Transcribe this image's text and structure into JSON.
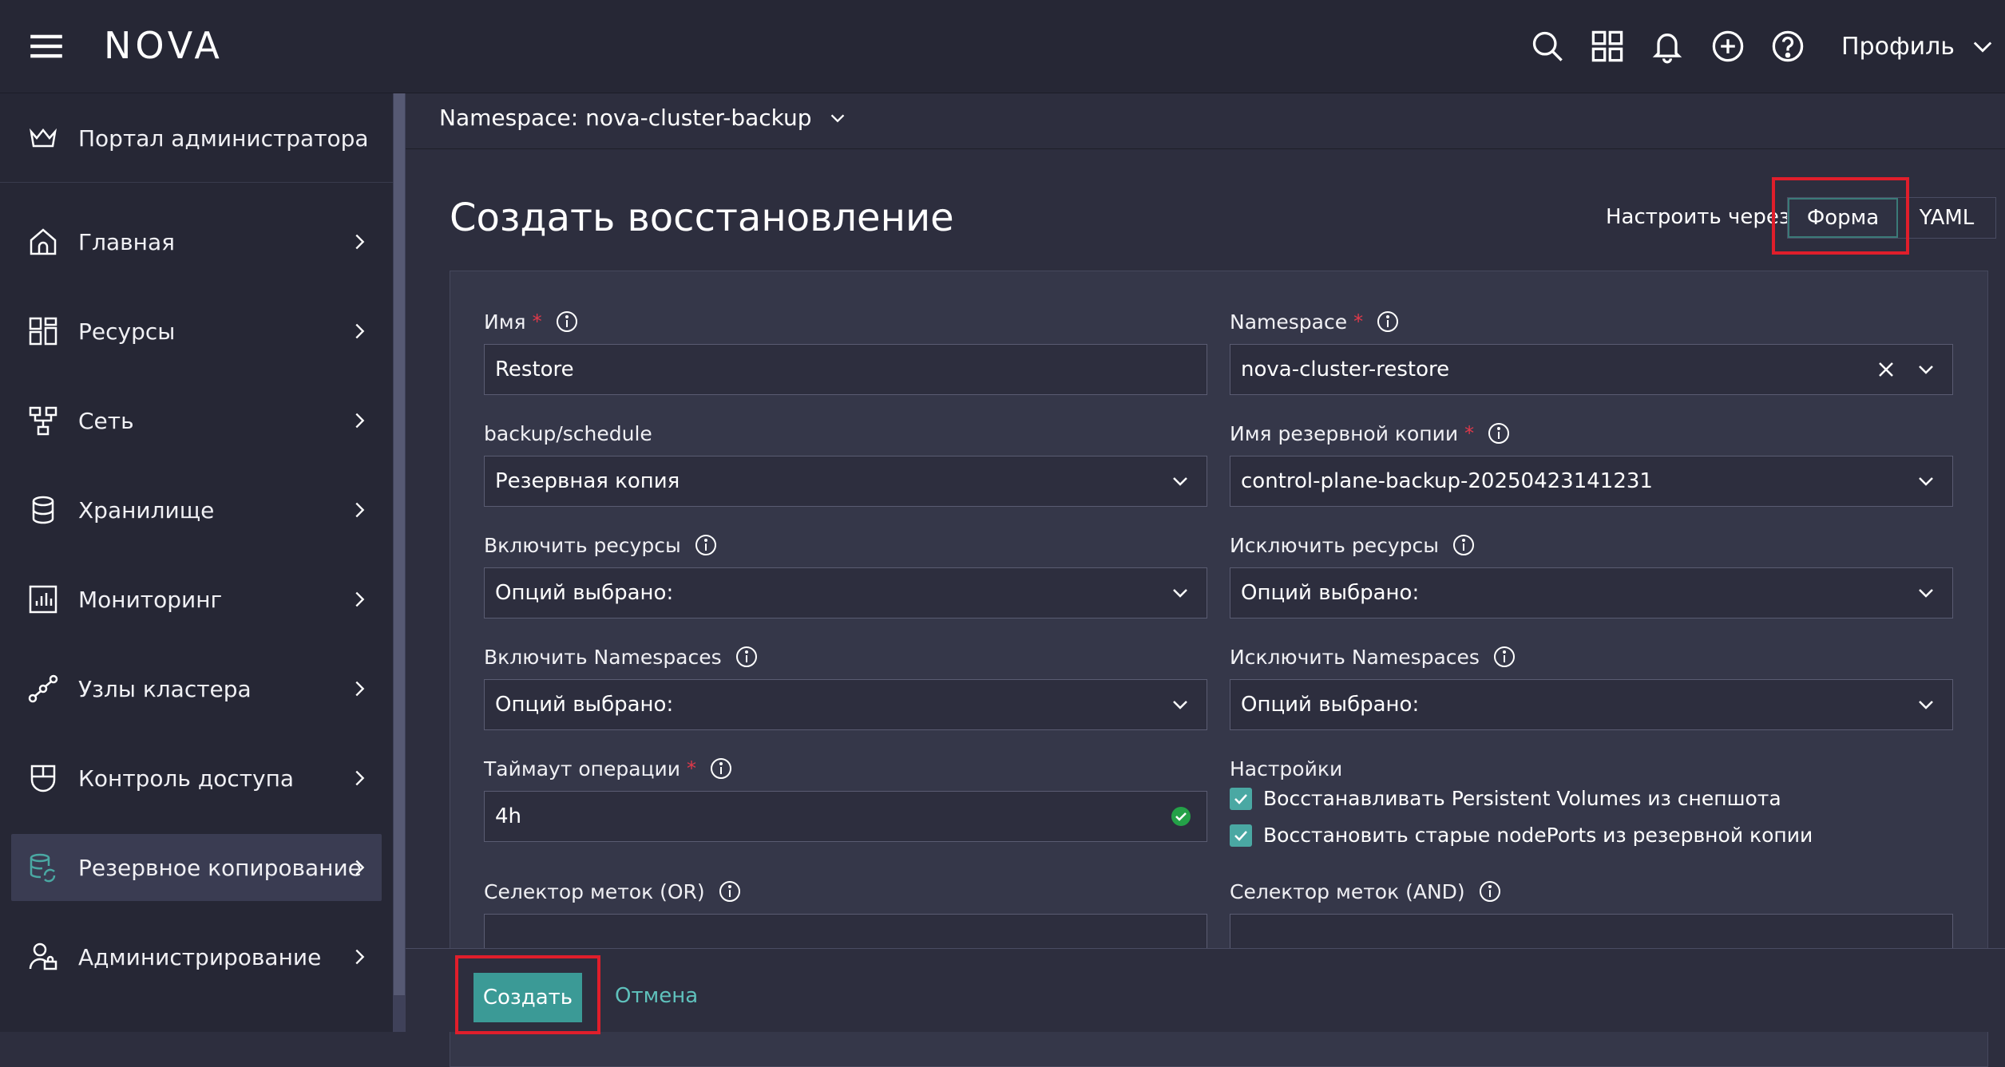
{
  "app": {
    "logo": "NOVA"
  },
  "topbar": {
    "profile_label": "Профиль"
  },
  "sidebar": {
    "admin_portal": "Портал администратора",
    "items": [
      {
        "label": "Главная"
      },
      {
        "label": "Ресурсы"
      },
      {
        "label": "Сеть"
      },
      {
        "label": "Хранилище"
      },
      {
        "label": "Мониторинг"
      },
      {
        "label": "Узлы кластера"
      },
      {
        "label": "Контроль доступа"
      },
      {
        "label": "Резервное копирование",
        "active": true
      },
      {
        "label": "Администрирование"
      }
    ]
  },
  "namespace_bar": {
    "label": "Namespace: nova-cluster-backup"
  },
  "page": {
    "title": "Создать восстановление",
    "configure_via": "Настроить через:",
    "mode_form": "Форма",
    "mode_yaml": "YAML"
  },
  "form": {
    "name": {
      "label": "Имя",
      "required": "*",
      "value": "Restore"
    },
    "namespace": {
      "label": "Namespace",
      "required": "*",
      "value": "nova-cluster-restore"
    },
    "backup_schedule": {
      "label": "backup/schedule",
      "value": "Резервная копия"
    },
    "backup_name": {
      "label": "Имя резервной копии",
      "required": "*",
      "value": "control-plane-backup-20250423141231"
    },
    "include_resources": {
      "label": "Включить ресурсы",
      "value": "Опций выбрано:"
    },
    "exclude_resources": {
      "label": "Исключить ресурсы",
      "value": "Опций выбрано:"
    },
    "include_namespaces": {
      "label": "Включить Namespaces",
      "value": "Опций выбрано:"
    },
    "exclude_namespaces": {
      "label": "Исключить Namespaces",
      "value": "Опций выбрано:"
    },
    "timeout": {
      "label": "Таймаут операции",
      "required": "*",
      "value": "4h"
    },
    "settings": {
      "label": "Настройки",
      "options": [
        {
          "label": "Восстанавливать Persistent Volumes из снепшота",
          "checked": true
        },
        {
          "label": "Восстановить старые nodePorts из резервной копии",
          "checked": true
        }
      ]
    },
    "label_selector_or": {
      "label": "Селектор меток (OR)",
      "value": ""
    },
    "label_selector_and": {
      "label": "Селектор меток (AND)",
      "value": ""
    }
  },
  "footer": {
    "create_label": "Создать",
    "cancel_label": "Отмена"
  },
  "colors": {
    "accent": "#3b9a96",
    "highlight": "#e01e2b",
    "required": "#e0394a",
    "success": "#24a148"
  }
}
